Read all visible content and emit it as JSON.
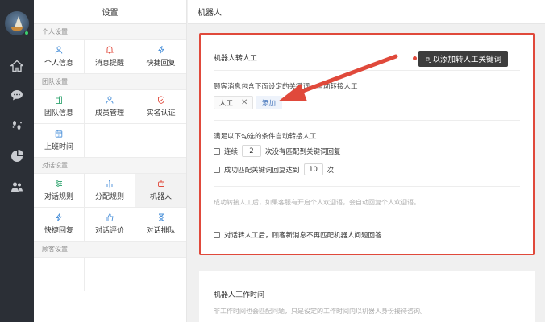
{
  "rail": {
    "icons": [
      "home-icon",
      "chat-icon",
      "footprint-icon",
      "analytics-icon",
      "team-icon"
    ]
  },
  "nav": {
    "title": "设置",
    "sections": [
      {
        "title": "个人设置",
        "items": [
          {
            "label": "个人信息",
            "icon": "user-icon",
            "color": "#4a90d9"
          },
          {
            "label": "消息提醒",
            "icon": "bell-icon",
            "color": "#e0493b"
          },
          {
            "label": "快捷回复",
            "icon": "lightning-icon",
            "color": "#4a90d9"
          }
        ]
      },
      {
        "title": "团队设置",
        "items": [
          {
            "label": "团队信息",
            "icon": "building-icon",
            "color": "#3aa876"
          },
          {
            "label": "成员管理",
            "icon": "members-icon",
            "color": "#4a90d9"
          },
          {
            "label": "实名认证",
            "icon": "shield-icon",
            "color": "#e0493b"
          },
          {
            "label": "上班时间",
            "icon": "calendar-icon",
            "color": "#4a90d9"
          }
        ]
      },
      {
        "title": "对话设置",
        "items": [
          {
            "label": "对话规则",
            "icon": "sliders-icon",
            "color": "#3aa876"
          },
          {
            "label": "分配规则",
            "icon": "distribute-icon",
            "color": "#4a90d9"
          },
          {
            "label": "机器人",
            "icon": "robot-icon",
            "color": "#e0493b",
            "active": true
          },
          {
            "label": "快捷回复",
            "icon": "lightning-icon",
            "color": "#4a90d9"
          },
          {
            "label": "对话评价",
            "icon": "thumbs-up-icon",
            "color": "#4a90d9"
          },
          {
            "label": "对话排队",
            "icon": "hourglass-icon",
            "color": "#4a90d9"
          }
        ]
      },
      {
        "title": "顾客设置",
        "items": []
      }
    ]
  },
  "main": {
    "title": "机器人",
    "card": {
      "title": "机器人转人工",
      "keyword_desc": "顾客消息包含下面设定的关键词，自动转接人工",
      "keyword_tag": "人工",
      "tag_close": "✕",
      "add_button": "添加",
      "auto_desc": "满足以下勾选的条件自动转接人工",
      "cond1_prefix": "连续",
      "cond1_value": "2",
      "cond1_suffix": "次没有匹配到关键词回复",
      "cond2_prefix": "成功匹配关键词回复达到",
      "cond2_value": "10",
      "cond2_suffix": "次",
      "hint": "成功转接人工后，如果客服有开启个人欢迎语，会自动回复个人欢迎语。",
      "last_option": "对话转人工后，顾客新消息不再匹配机器人问题回答"
    },
    "tooltip": "可以添加转人工关键词",
    "card2": {
      "title": "机器人工作时间",
      "subtitle": "非工作时间也会匹配问题，只是设定的工作时间内以机器人身份接待咨询。"
    }
  },
  "colors": {
    "highlight": "#e0493b",
    "accent": "#3c6fb8",
    "rail": "#2b2f36"
  }
}
